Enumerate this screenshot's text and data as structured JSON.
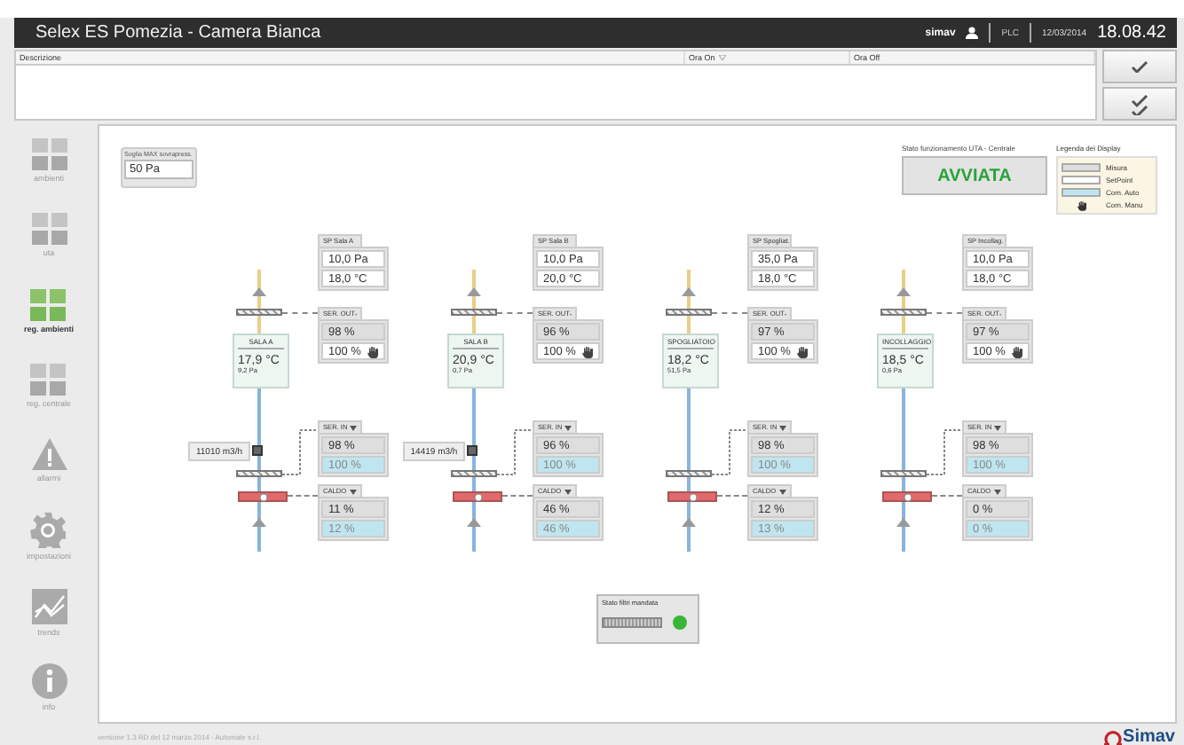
{
  "window": {
    "title": "Selex ES Pomezia - Camera Bianca"
  },
  "header": {
    "user": "simav",
    "plc": "PLC",
    "date": "12/03/2014",
    "time": "18.08.42"
  },
  "alarm_table": {
    "columns": [
      {
        "label": "Descrizione",
        "sorted": false
      },
      {
        "label": "Ora On",
        "sorted": true
      },
      {
        "label": "Ora Off",
        "sorted": false
      }
    ]
  },
  "alarm_buttons": [
    {
      "kind": "acknowledge"
    },
    {
      "kind": "acknowledge_all"
    }
  ],
  "sidebar": {
    "items": [
      {
        "label": "ambienti",
        "kind": "grid",
        "selected": false
      },
      {
        "label": "uta",
        "kind": "grid",
        "selected": false
      },
      {
        "label": "reg. ambienti",
        "kind": "grid",
        "selected": true
      },
      {
        "label": "reg. centrale",
        "kind": "grid",
        "selected": false
      },
      {
        "label": "allarmi",
        "kind": "warning",
        "selected": false
      },
      {
        "label": "impostazioni",
        "kind": "gear",
        "selected": false
      },
      {
        "label": "trends",
        "kind": "chart",
        "selected": false
      },
      {
        "label": "info",
        "kind": "info",
        "selected": false
      }
    ]
  },
  "threshold": {
    "label": "Soglia MAX sovrapress.",
    "value": "50 Pa"
  },
  "uta_status": {
    "label": "Stato funzionamento UTA - Centrale",
    "value": "AVVIATA",
    "running": true
  },
  "legend": {
    "title": "Legenda dei Display",
    "items": [
      {
        "kind": "measure",
        "label": "Misura"
      },
      {
        "kind": "setpoint",
        "label": "SetPoint"
      },
      {
        "kind": "auto",
        "label": "Com. Auto"
      },
      {
        "kind": "manual",
        "label": "Com. Manu"
      }
    ]
  },
  "rooms": [
    {
      "name": "SALA A",
      "temperature": "17,9 °C",
      "pressure": "9,2 Pa",
      "airflow": "11010 m3/h",
      "setpoint": {
        "label": "SP Sala A",
        "pressure": "10,0 Pa",
        "temperature": "18,0 °C"
      },
      "ser_out": {
        "label": "SER. OUT",
        "measure": "98 %",
        "command": "100 %",
        "manual": true
      },
      "ser_in": {
        "label": "SER. IN",
        "measure": "98 %",
        "command": "100 %",
        "manual": false
      },
      "heating": {
        "label": "CALDO",
        "measure": "11 %",
        "command": "12 %",
        "manual": false
      }
    },
    {
      "name": "SALA B",
      "temperature": "20,9 °C",
      "pressure": "0,7 Pa",
      "airflow": "14419 m3/h",
      "setpoint": {
        "label": "SP Sala B",
        "pressure": "10,0 Pa",
        "temperature": "20,0 °C"
      },
      "ser_out": {
        "label": "SER. OUT",
        "measure": "96 %",
        "command": "100 %",
        "manual": true
      },
      "ser_in": {
        "label": "SER. IN",
        "measure": "96 %",
        "command": "100 %",
        "manual": false
      },
      "heating": {
        "label": "CALDO",
        "measure": "46 %",
        "command": "46 %",
        "manual": false
      }
    },
    {
      "name": "SPOGLIATOIO",
      "temperature": "18,2 °C",
      "pressure": "51,5 Pa",
      "setpoint": {
        "label": "SP Spogliat.",
        "pressure": "35,0 Pa",
        "temperature": "18,0 °C"
      },
      "ser_out": {
        "label": "SER. OUT",
        "measure": "97 %",
        "command": "100 %",
        "manual": true
      },
      "ser_in": {
        "label": "SER. IN",
        "measure": "98 %",
        "command": "100 %",
        "manual": false
      },
      "heating": {
        "label": "CALDO",
        "measure": "12 %",
        "command": "13 %",
        "manual": false
      }
    },
    {
      "name": "INCOLLAGGIO",
      "temperature": "18,5 °C",
      "pressure": "0,6 Pa",
      "setpoint": {
        "label": "SP Incollag.",
        "pressure": "10,0 Pa",
        "temperature": "18,0 °C"
      },
      "ser_out": {
        "label": "SER. OUT",
        "measure": "97 %",
        "command": "100 %",
        "manual": true
      },
      "ser_in": {
        "label": "SER. IN",
        "measure": "98 %",
        "command": "100 %",
        "manual": false
      },
      "heating": {
        "label": "CALDO",
        "measure": "0 %",
        "command": "0 %",
        "manual": false
      }
    }
  ],
  "filter_status": {
    "label": "Stato filtri mandata",
    "ok": true
  },
  "footer": {
    "version": "versione 1.3 RD del 12 marzo 2014 - Automate s.r.l.",
    "logo": "Simav"
  }
}
